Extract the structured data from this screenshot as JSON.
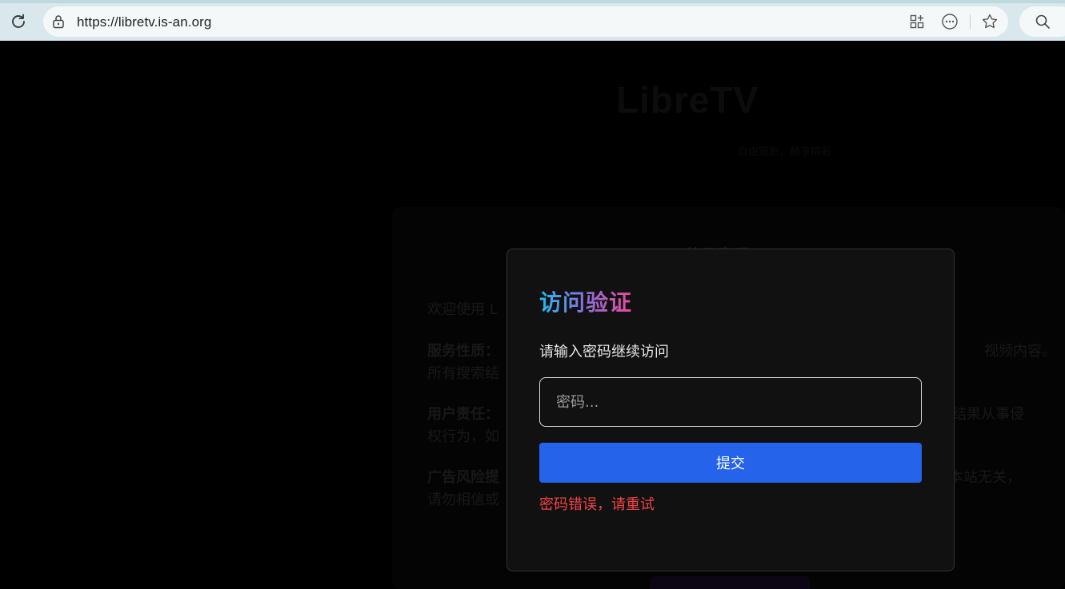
{
  "browser": {
    "url": "https://libretv.is-an.org"
  },
  "background_page": {
    "logo": "LibreTV",
    "tagline": "自由观影，畅享精彩",
    "disclaimer": {
      "title": "使用声明",
      "intro": "欢迎使用 L",
      "p1_label": "服务性质：",
      "p1_tail_right": "视频内容。",
      "p1_line2": "所有搜索结",
      "p2_label": "用户责任：",
      "p2_tail_right": "结果从事侵",
      "p2_line2": "权行为，如",
      "p3_label": "广告风险提",
      "p3_tail_right": "本站无关，",
      "p3_line2": "请勿相信或"
    }
  },
  "modal": {
    "title": "访问验证",
    "subtitle": "请输入密码继续访问",
    "password_placeholder": "密码...",
    "submit_label": "提交",
    "error_message": "密码错误，请重试"
  },
  "colors": {
    "accent": "#2563eb",
    "error": "#ef4444",
    "title_gradient": [
      "#22b8f0",
      "#8b6fd6",
      "#ec4899"
    ],
    "modal_bg": "#111111"
  }
}
